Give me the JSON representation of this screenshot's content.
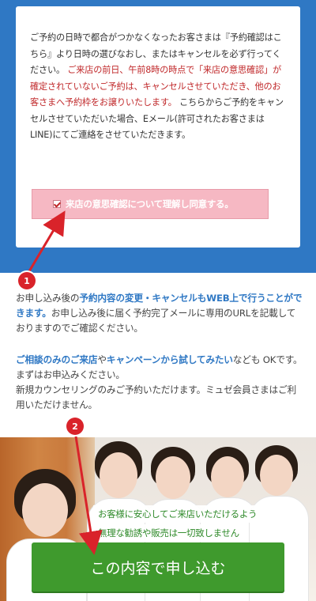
{
  "notice": {
    "text_1": "ご予約の日時で都合がつかなくなったお客さまは『予約確認はこちら』より日時の選びなおし、またはキャンセルを必ず行ってください。",
    "text_red": "ご来店の前日、午前8時の時点で「来店の意思確認」が確定されていないご予約は、キャンセルさせていただき、他のお客さまへ予約枠をお譲りいたします。",
    "text_2": "こちらからご予約をキャンセルさせていただいた場合、Eメール(許可されたお客さまはLINE)にてご連絡をさせていただきます。"
  },
  "consent": {
    "label": "来店の意思確認について理解し同意する。",
    "checked": true
  },
  "info1": {
    "text_a": "お申し込み後の",
    "highlight": "予約内容の変更・キャンセルもWEB上で行うことができます。",
    "text_b": "お申し込み後に届く予約完了メールに専用のURLを記載しておりますのでご確認ください。"
  },
  "info2": {
    "highlight_a": "ご相談のみのご来店",
    "text_a": "や",
    "highlight_b": "キャンペーンから試してみたい",
    "text_b": "なども OKです。まずはお申込みください。",
    "text_c": "新規カウンセリングのみご予約いただけます。ミュゼ会員さまはご利用いただけません。"
  },
  "banner": {
    "tag_1": "お客様に安心してご来店いただけるよう",
    "tag_2": "無理な勧誘や販売は一切致しません"
  },
  "cta": {
    "label": "この内容で申し込む"
  },
  "annotations": {
    "badge_1": "1",
    "badge_2": "2"
  },
  "colors": {
    "blue": "#2f78c4",
    "red": "#c0282a",
    "green": "#3f9a2d",
    "pink": "#f6b8c3",
    "badge": "#d9232a"
  }
}
